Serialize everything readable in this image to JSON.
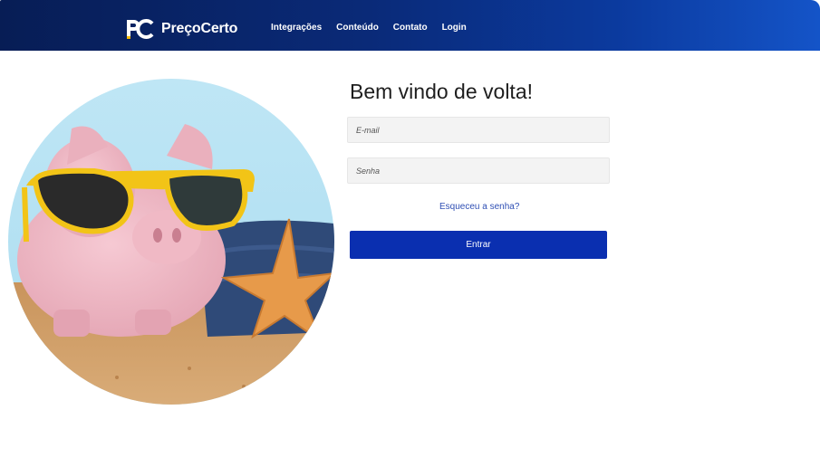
{
  "header": {
    "brand_name": "PreçoCerto",
    "nav": [
      "Integrações",
      "Conteúdo",
      "Contato",
      "Login"
    ]
  },
  "login": {
    "title": "Bem vindo de volta!",
    "email_placeholder": "E-mail",
    "password_placeholder": "Senha",
    "forgot_label": "Esqueceu a senha?",
    "submit_label": "Entrar"
  },
  "colors": {
    "header_start": "#071d55",
    "header_end": "#1454c8",
    "primary_button": "#0a2fb0",
    "link": "#2f4fb4"
  },
  "hero_image": {
    "icon": "piggy-bank-beach-photo"
  }
}
